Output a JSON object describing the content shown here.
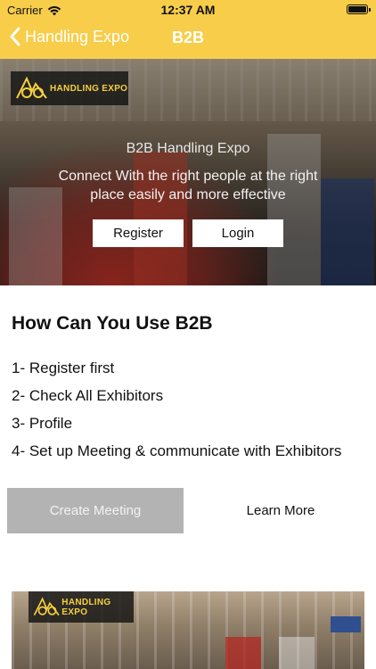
{
  "status_bar": {
    "carrier": "Carrier",
    "time": "12:37 AM"
  },
  "nav": {
    "back_label": "Handling Expo",
    "title": "B2B"
  },
  "hero": {
    "logo_text": "HANDLING EXPO",
    "title": "B2B Handling Expo",
    "subtitle": "Connect With the right people at the right place easily and more effective",
    "register_label": "Register",
    "login_label": "Login"
  },
  "content": {
    "heading": "How Can You Use B2B",
    "steps": [
      "1- Register first",
      "2- Check All Exhibitors",
      "3- Profile",
      "4- Set up Meeting & communicate with Exhibitors"
    ],
    "create_meeting_label": "Create Meeting",
    "learn_more_label": "Learn More"
  },
  "bottom_image": {
    "logo_text": "HANDLING EXPO"
  },
  "colors": {
    "accent_yellow": "#f8cd4a",
    "logo_yellow": "#f4d03f",
    "disabled_button": "#b3b3b3"
  },
  "icons": [
    "wifi-icon",
    "battery-icon",
    "chevron-left-icon",
    "expo-logo-icon"
  ]
}
